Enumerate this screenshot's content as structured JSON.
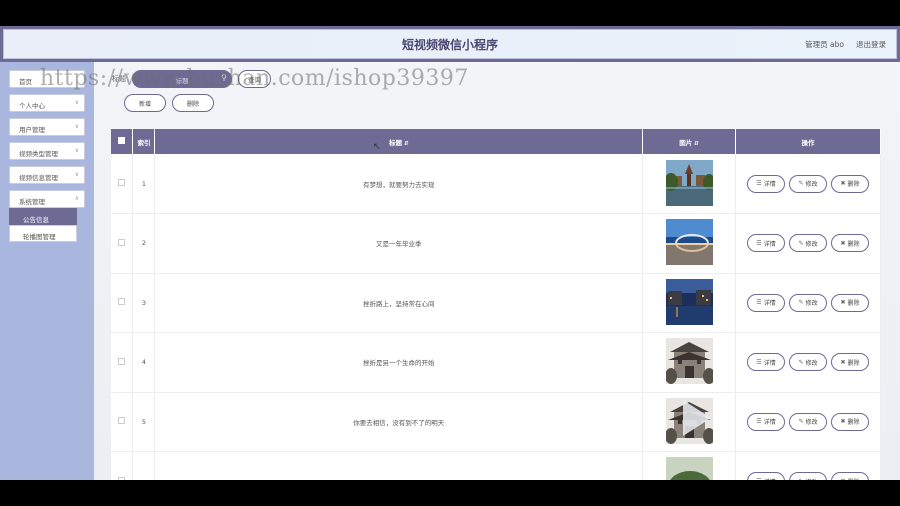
{
  "header": {
    "title": "短视频微信小程序",
    "user": "管理员 abo",
    "logout": "退出登录"
  },
  "watermark": "https://www.huzhan.com/ishop39397",
  "sidebar": {
    "items": [
      {
        "label": "首页",
        "chevron": false
      },
      {
        "label": "个人中心",
        "chevron": true
      },
      {
        "label": "用户管理",
        "chevron": true
      },
      {
        "label": "视频类型管理",
        "chevron": true
      },
      {
        "label": "视频信息管理",
        "chevron": true
      },
      {
        "label": "系统管理",
        "chevron": true
      }
    ],
    "submenu": [
      {
        "label": "公告信息",
        "active": true
      },
      {
        "label": "轮播图管理",
        "active": false
      }
    ]
  },
  "search": {
    "label": "标题",
    "placeholder": "标题",
    "query_button": "查询"
  },
  "toolbar": {
    "add": "新增",
    "delete": "删除"
  },
  "table": {
    "headers": {
      "index": "索引",
      "title": "标题",
      "image": "图片",
      "actions": "操作"
    },
    "rows": [
      {
        "index": "1",
        "title": "有梦想，就要努力去实现",
        "thumb": "pagoda-lake"
      },
      {
        "index": "2",
        "title": "又是一年毕业季",
        "thumb": "bridge-sky"
      },
      {
        "index": "3",
        "title": "挫折路上，坚持常在心间",
        "thumb": "canal-night"
      },
      {
        "index": "4",
        "title": "挫折是另一个生命的开始",
        "thumb": "ancient-gate"
      },
      {
        "index": "5",
        "title": "你要去相信，没有到不了的明天",
        "thumb": "ancient-gate"
      },
      {
        "index": "",
        "title": "",
        "thumb": "green-hill"
      }
    ],
    "row_actions": {
      "detail": "详情",
      "edit": "修改",
      "delete": "删除"
    }
  },
  "colors": {
    "primary": "#6d6a94",
    "sidebar": "#a9b7de",
    "background": "#eef0f6"
  }
}
